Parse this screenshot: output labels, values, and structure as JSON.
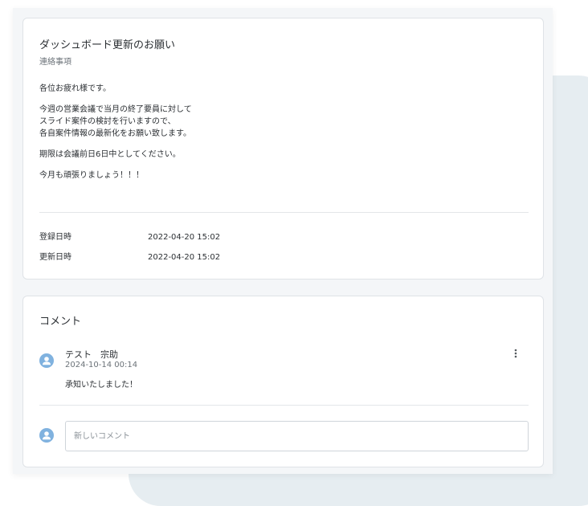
{
  "notice": {
    "title": "ダッシュボード更新のお願い",
    "category": "連絡事項",
    "body": {
      "greeting": "各位お疲れ様です。",
      "paragraph2": [
        "今週の営業会議で当月の終了要員に対して",
        "スライド案件の検討を行いますので、",
        "各自案件情報の最新化をお願い致します。"
      ],
      "deadline": "期限は会議前日6日中としてください。",
      "closing": "今月も頑張りましょう！！！"
    },
    "meta": {
      "created_label": "登録日時",
      "created_value": "2022-04-20 15:02",
      "updated_label": "更新日時",
      "updated_value": "2022-04-20 15:02"
    }
  },
  "comments": {
    "title": "コメント",
    "items": [
      {
        "author": "テスト　宗助",
        "timestamp": "2024-10-14 00:14",
        "text": "承知いたしました！",
        "avatar_icon": "user-avatar-icon",
        "menu_icon": "more-vertical-icon"
      }
    ],
    "new_comment": {
      "placeholder": "新しいコメント",
      "value": "",
      "avatar_icon": "user-avatar-icon"
    }
  },
  "colors": {
    "avatar": "#80b2df",
    "background_decor": "#e6edf1",
    "panel": "#f4f6f8",
    "card_border": "#dfe3e7"
  }
}
